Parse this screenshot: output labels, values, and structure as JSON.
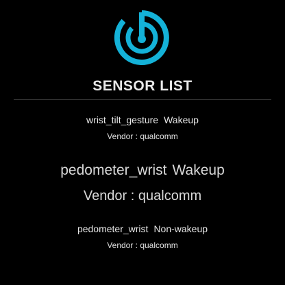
{
  "header": {
    "logo_icon": "sensor-radar-icon",
    "accent_color": "#14B2D8",
    "title": "SENSOR LIST"
  },
  "sensors": [
    {
      "name": "wrist_tilt_gesture",
      "type": "Wakeup",
      "vendor": "Vendor : qualcomm"
    },
    {
      "name": "pedometer_wrist",
      "type": "Wakeup",
      "vendor": "Vendor : qualcomm"
    },
    {
      "name": "pedometer_wrist",
      "type": "Non-wakeup",
      "vendor": "Vendor : qualcomm"
    }
  ]
}
